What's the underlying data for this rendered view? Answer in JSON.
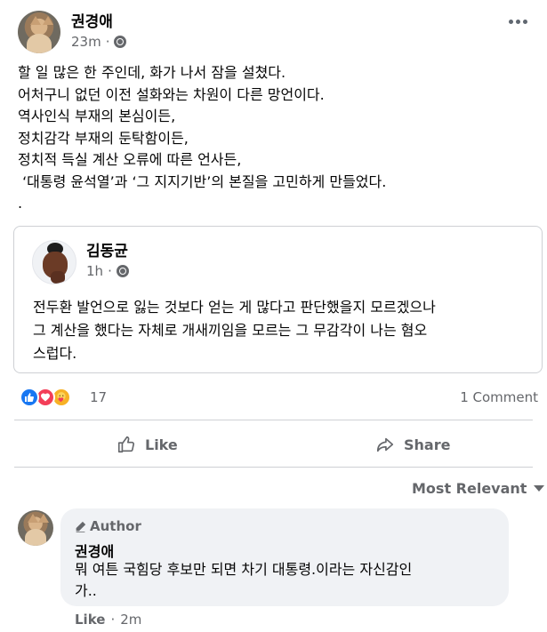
{
  "post": {
    "author": "권경애",
    "time": "23m",
    "dot": "·",
    "text": "할 일 많은 한 주인데, 화가 나서 잠을 설쳤다.\n어처구니 없던 이전 설화와는 차원이 다른 망언이다.\n역사인식 부재의 본심이든,\n정치감각 부재의 둔탁함이든,\n정치적 득실 계산 오류에 따른 언사든,\n ‘대통령 윤석열’과 ‘그 지지기반’의 본질을 고민하게 만들었다.\n."
  },
  "shared": {
    "author": "김동균",
    "time": "1h",
    "dot": "·",
    "text": "전두환 발언으로 잃는 것보다 얻는 게 많다고 판단했을지 모르겠으나\n그 계산을 했다는 자체로 개새끼임을 모르는 그 무감각이 나는 혐오\n스럽다."
  },
  "reactions": {
    "count": "17",
    "comment_count": "1 Comment",
    "icons": [
      "like-icon",
      "love-icon",
      "care-icon"
    ]
  },
  "actions": {
    "like_label": "Like",
    "share_label": "Share"
  },
  "comments": {
    "sort_label": "Most Relevant",
    "items": [
      {
        "badge": "Author",
        "author": "권경애",
        "text": "뭐 여튼 국힘당 후보만 되면 차기 대통령.이라는 자신감인\n가..",
        "like_label": "Like",
        "dot": "·",
        "time": "2m"
      }
    ]
  },
  "colors": {
    "accent": "#1877f2",
    "secondary_text": "#65676b",
    "bubble_bg": "#f0f2f5"
  }
}
